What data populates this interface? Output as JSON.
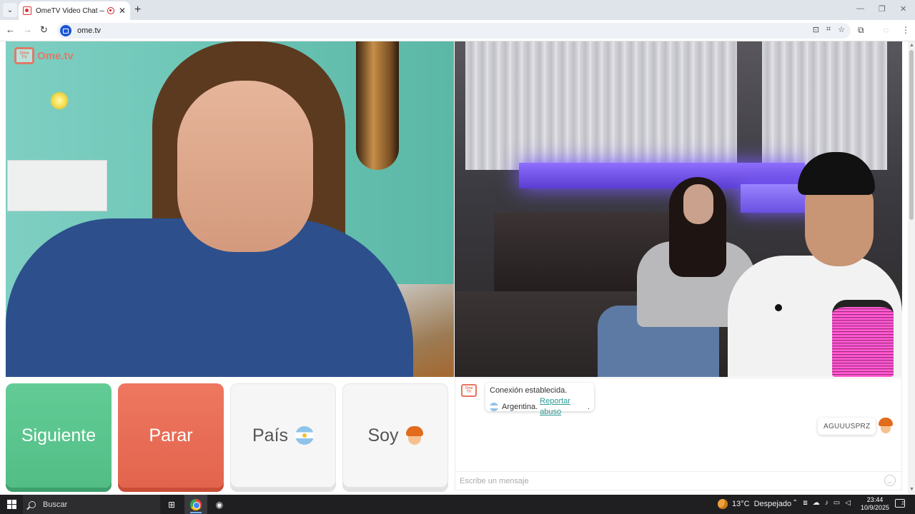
{
  "browser": {
    "tab_title": "OmeTV Video Chat — Ome",
    "tab_close": "✕",
    "new_tab": "+",
    "url": "ome.tv",
    "tab_menu_glyph": "⌄",
    "nav": {
      "back": "←",
      "forward": "→",
      "reload": "↻"
    },
    "window_controls": {
      "minimize": "—",
      "maximize": "❐",
      "close": "✕"
    },
    "toolbar_icons": [
      "install-icon",
      "translate-icon",
      "star-icon",
      "extensions-icon",
      "profile-icon",
      "menu-icon"
    ]
  },
  "page": {
    "logo_tv_text": "Ome TV",
    "logo_text": "Ome.tv",
    "buttons": {
      "next": "Siguiente",
      "stop": "Parar",
      "country": "País",
      "gender": "Soy"
    },
    "chat": {
      "logo_text": "Ome TV",
      "system_line1": "Conexión establecida.",
      "system_country": "Argentina.",
      "report_link": "Reportar abuso",
      "report_suffix": ".",
      "username": "AGUUUSPRZ",
      "input_placeholder": "Escribe un mensaje"
    }
  },
  "taskbar": {
    "search_label": "Buscar",
    "weather_temp": "13°C",
    "weather_text": "Despejado",
    "time": "23:44",
    "date": "10/9/2025",
    "notification_count": "2",
    "tray_chevron": "⌃"
  },
  "colors": {
    "next_button": "#52be86",
    "stop_button": "#e3644d",
    "link": "#2f9a93",
    "logo": "#e8735f"
  }
}
